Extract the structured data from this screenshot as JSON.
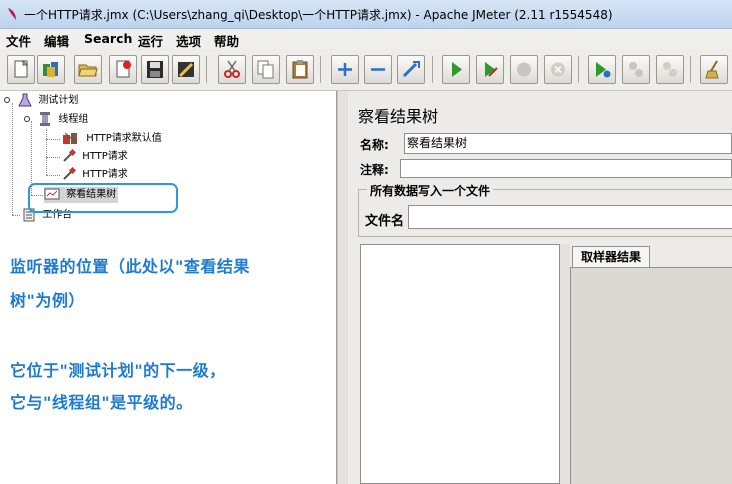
{
  "window": {
    "title": "一个HTTP请求.jmx (C:\\Users\\zhang_qi\\Desktop\\一个HTTP请求.jmx) - Apache JMeter (2.11 r1554548)"
  },
  "menu": [
    "文件",
    "编辑",
    "Search",
    "运行",
    "选项",
    "帮助"
  ],
  "toolbar": {
    "buttons": [
      "new-icon",
      "templates-icon",
      "open-icon",
      "close-icon",
      "save-icon",
      "save-screenshot-icon",
      "cut-icon",
      "copy-icon",
      "paste-icon",
      "expand-icon",
      "collapse-icon",
      "toggle-icon",
      "start-icon",
      "start-no-pause-icon",
      "stop-icon",
      "shutdown-icon",
      "remote-start-icon",
      "remote-stop-icon",
      "remote-shutdown-icon",
      "clear-icon"
    ]
  },
  "tree": {
    "test_plan": "测试计划",
    "thread_group": "线程组",
    "http_defaults": "HTTP请求默认值",
    "http_request_1": "HTTP请求",
    "http_request_2": "HTTP请求",
    "view_results_tree": "察看结果树",
    "workbench": "工作台"
  },
  "annotation": {
    "line1": "监听器的位置（此处以\"查看结果",
    "line2": "树\"为例）",
    "line3": "它位于\"测试计划\"的下一级，",
    "line4": "它与\"线程组\"是平级的。"
  },
  "panel": {
    "title": "察看结果树",
    "name_label": "名称:",
    "name_value": "察看结果树",
    "comment_label": "注释:",
    "comment_value": "",
    "file_group_title": "所有数据写入一个文件",
    "filename_label": "文件名",
    "filename_value": "",
    "tab_label": "取样器结果"
  },
  "colors": {
    "annotation": "#1f7bd1",
    "highlight_border": "#2a9ad6"
  }
}
